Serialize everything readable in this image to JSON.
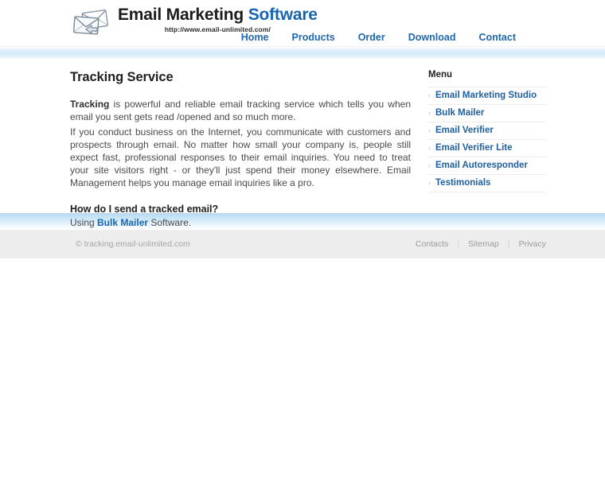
{
  "header": {
    "logo": {
      "icon": "envelopes-icon",
      "title_dark": "Email Marketing",
      "title_blue": "Software",
      "url": "http://www.email-unlimited.com/"
    },
    "nav": [
      {
        "label": "Home"
      },
      {
        "label": "Products"
      },
      {
        "label": "Order"
      },
      {
        "label": "Download"
      },
      {
        "label": "Contact"
      }
    ]
  },
  "main": {
    "title": "Tracking Service",
    "paragraph1_lead": "Tracking",
    "paragraph1_rest": " is powerful and reliable email tracking service which tells you when email you sent gets read /opened  and so much more.",
    "paragraph2": "If you conduct business on the Internet, you communicate with customers and prospects through email. No matter how small your company is, people still expect fast, professional responses to their email inquiries. You need to treat your site visitors right - or they'll just spend their money elsewhere. Email Management helps you manage email inquiries like a pro.",
    "subtitle": "How do I send a tracked email?",
    "howto_prefix": "Using ",
    "howto_link": "Bulk Mailer",
    "howto_suffix": " Software."
  },
  "sidebar": {
    "heading": "Menu",
    "bullet": "›",
    "items": [
      {
        "label": "Email Marketing Studio"
      },
      {
        "label": "Bulk Mailer"
      },
      {
        "label": "Email Verifier"
      },
      {
        "label": "Email Verifier Lite"
      },
      {
        "label": "Email Autoresponder"
      },
      {
        "label": "Testimonials"
      }
    ]
  },
  "footer": {
    "copyright": "© tracking.email-unlimited.com",
    "links": [
      {
        "label": "Contacts"
      },
      {
        "label": "Sitemap"
      },
      {
        "label": "Privacy"
      }
    ],
    "separator": "|"
  },
  "colors": {
    "link_blue": "#1565b0",
    "nav_blue": "#2167ae",
    "sidebar_link": "#1f5fa0",
    "band_blue": "#b5d9f1",
    "footer_bg": "#ededed"
  }
}
